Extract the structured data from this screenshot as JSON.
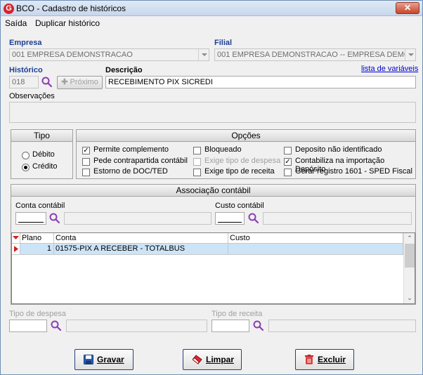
{
  "window": {
    "title": "BCO - Cadastro de históricos",
    "close_glyph": "✕",
    "app_icon_letter": "G"
  },
  "menu": {
    "items": [
      "Saída",
      "Duplicar histórico"
    ]
  },
  "empresa": {
    "label": "Empresa",
    "value": "001 EMPRESA DEMONSTRACAO"
  },
  "filial": {
    "label": "Filial",
    "value": "001 EMPRESA DEMONSTRACAO -- EMPRESA DEMON"
  },
  "historico": {
    "label": "Histórico",
    "value": "018",
    "next_label": "Próximo"
  },
  "descricao": {
    "label": "Descrição",
    "value": "RECEBIMENTO PIX SICREDI"
  },
  "variables_link": "lista de variáveis",
  "observacoes": {
    "label": "Observações",
    "value": ""
  },
  "tipo": {
    "title": "Tipo",
    "options": [
      {
        "label": "Débito",
        "selected": false
      },
      {
        "label": "Crédito",
        "selected": true
      }
    ]
  },
  "opcoes": {
    "title": "Opções",
    "items": [
      {
        "label": "Permite complemento",
        "checked": true,
        "enabled": true
      },
      {
        "label": "Pede contrapartida contábil",
        "checked": false,
        "enabled": true
      },
      {
        "label": "Estorno de DOC/TED",
        "checked": false,
        "enabled": true
      },
      {
        "label": "Bloqueado",
        "checked": false,
        "enabled": true
      },
      {
        "label": "Exige tipo de despesa",
        "checked": false,
        "enabled": false
      },
      {
        "label": "Exige tipo de receita",
        "checked": false,
        "enabled": true
      },
      {
        "label": "Deposito não identificado",
        "checked": false,
        "enabled": true
      },
      {
        "label": "Contabiliza na importação Depósito",
        "checked": true,
        "enabled": true
      },
      {
        "label": "Gerar registro 1601 - SPED Fiscal",
        "checked": false,
        "enabled": true
      }
    ]
  },
  "associacao": {
    "title": "Associação contábil",
    "conta_label": "Conta contábil",
    "custo_label": "Custo contábil",
    "grid": {
      "columns": [
        "Plano",
        "Conta",
        "Custo"
      ],
      "rows": [
        {
          "plano": "1",
          "conta": "01575-PIX A RECEBER - TOTALBUS",
          "custo": ""
        }
      ]
    }
  },
  "tipo_despesa": {
    "label": "Tipo de despesa"
  },
  "tipo_receita": {
    "label": "Tipo de receita"
  },
  "buttons": {
    "save": "Gravar",
    "clear": "Limpar",
    "delete": "Excluir"
  },
  "colors": {
    "label_blue": "#1c3f94",
    "selection_row": "#cde4f7",
    "link": "#0000cc",
    "marker_red": "#d02020"
  }
}
